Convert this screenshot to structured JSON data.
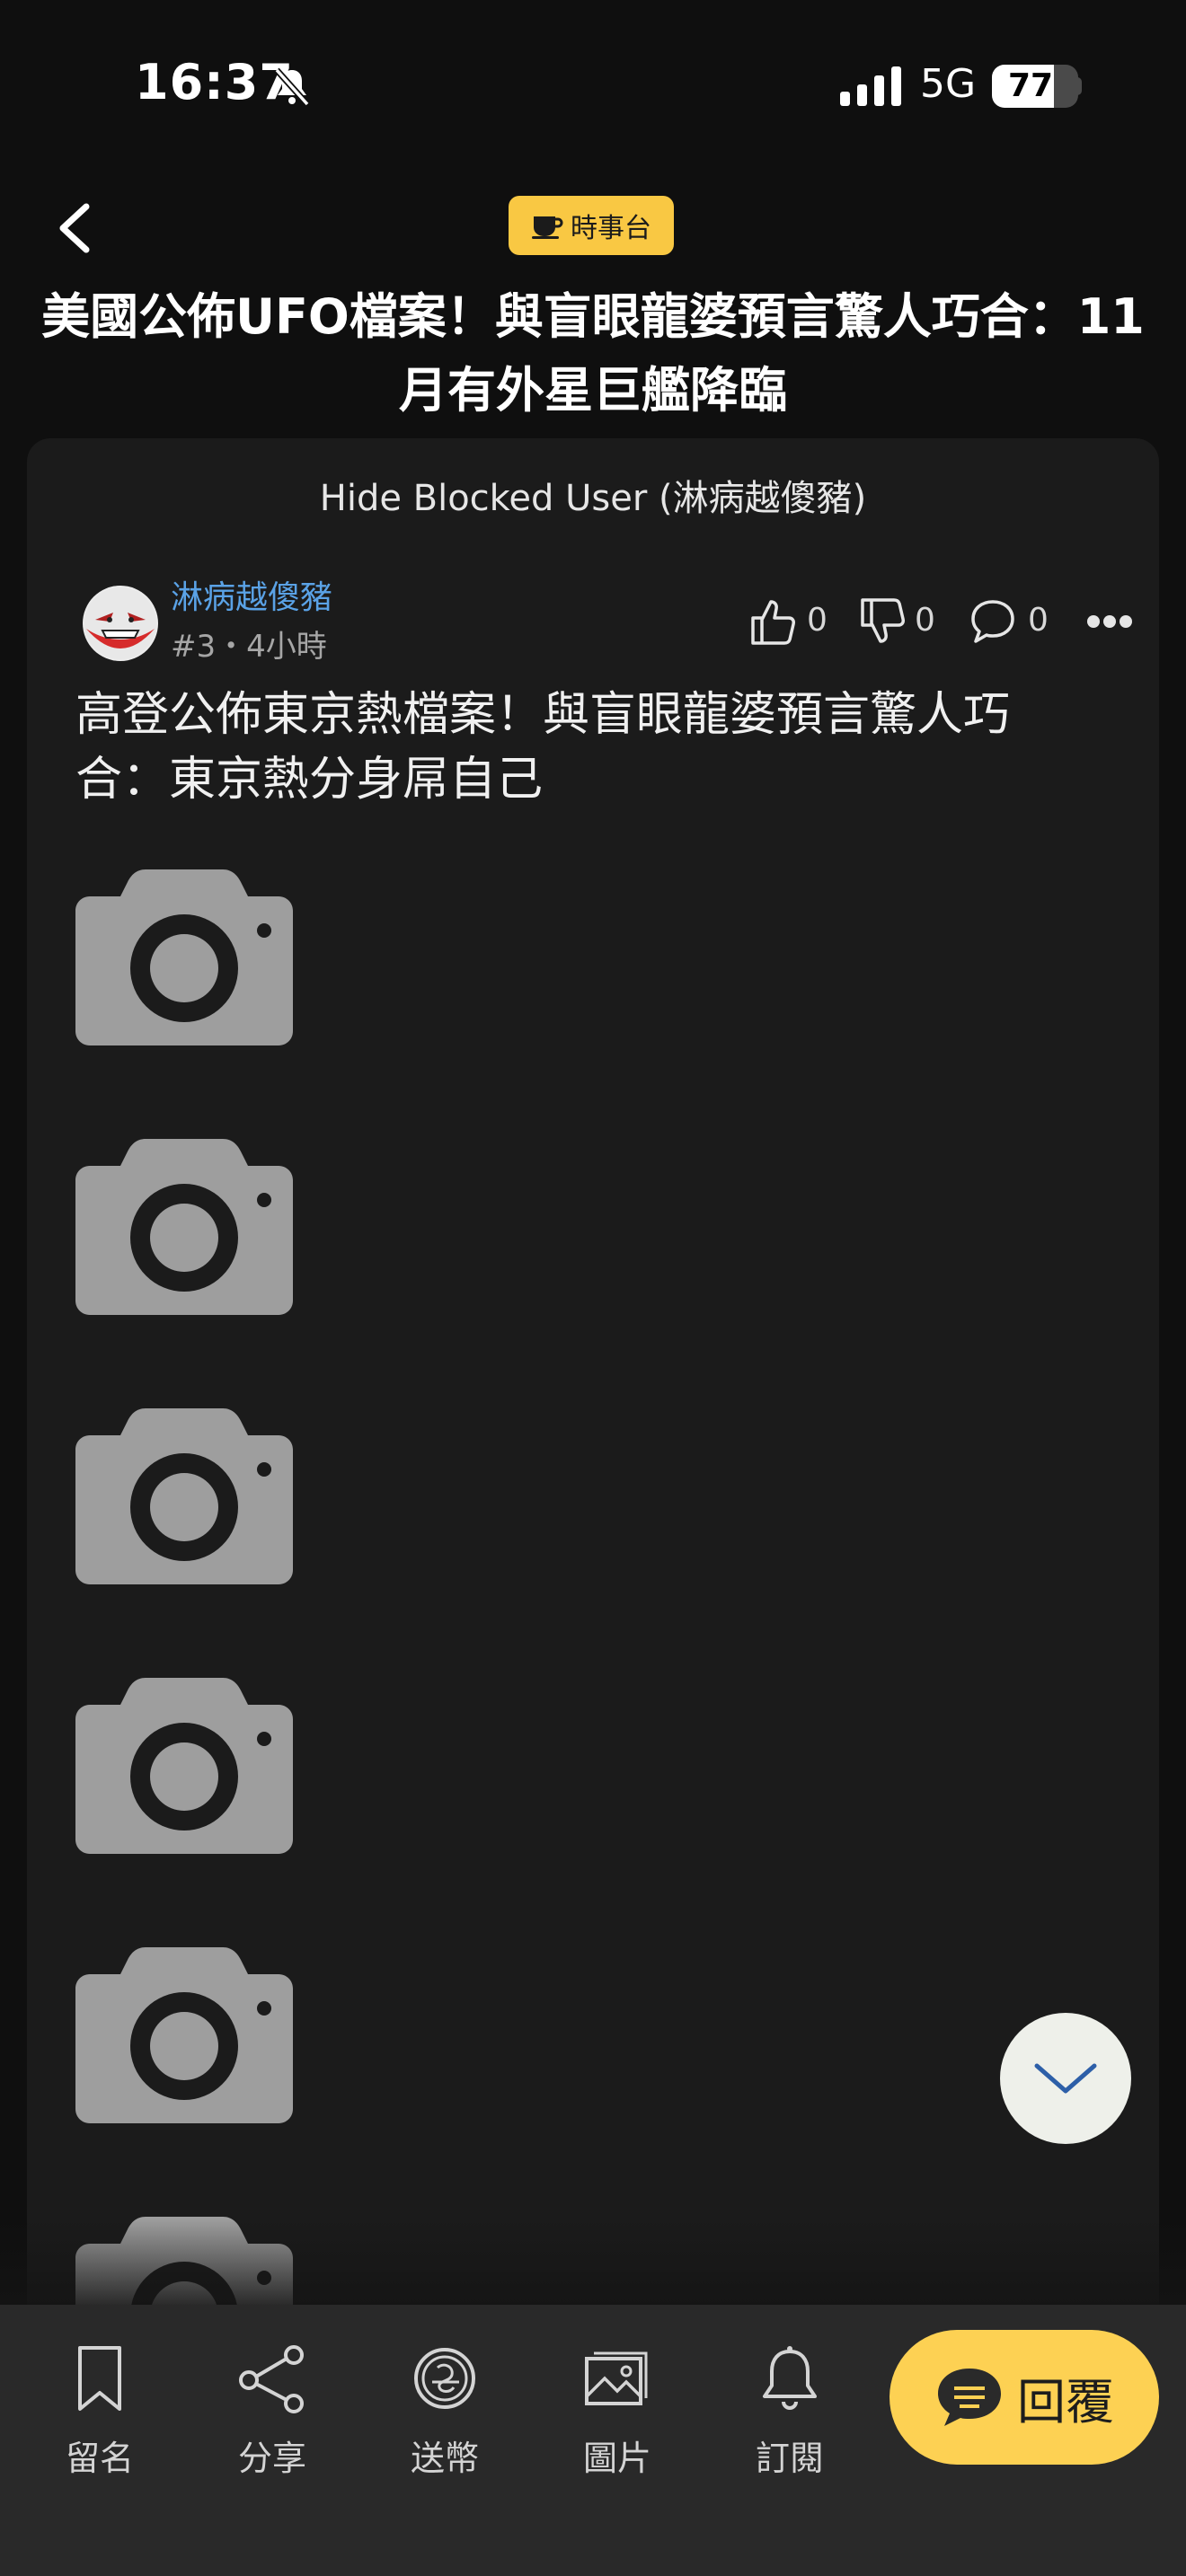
{
  "status_bar": {
    "time": "16:37",
    "network": "5G",
    "battery": "77",
    "battery_level": 0.77
  },
  "header": {
    "category": "時事台",
    "title_line1": "美國公佈UFO檔案！與盲眼龍婆預言驚人巧合：11",
    "title_line2": "月有外星巨艦降臨"
  },
  "post": {
    "hide_blocked": "Hide Blocked User (淋病越傻豬)",
    "username": "淋病越傻豬",
    "meta": "#3・4小時",
    "likes": "0",
    "dislikes": "0",
    "comments": "0",
    "body_line1": "高登公佈東京熱檔案！與盲眼龍婆預言驚人巧",
    "body_line2": "合：東京熱分身屌自己",
    "image_placeholder_count": 6
  },
  "toolbar": {
    "bookmark": "留名",
    "share": "分享",
    "send_coin": "送幣",
    "images": "圖片",
    "subscribe": "訂閱",
    "reply": "回覆"
  },
  "colors": {
    "accent": "#fdd153",
    "tag": "#f9c843",
    "username": "#5aa2e6",
    "card": "#1b1b1b",
    "toolbar": "#292929",
    "placeholder": "#9e9e9e"
  }
}
